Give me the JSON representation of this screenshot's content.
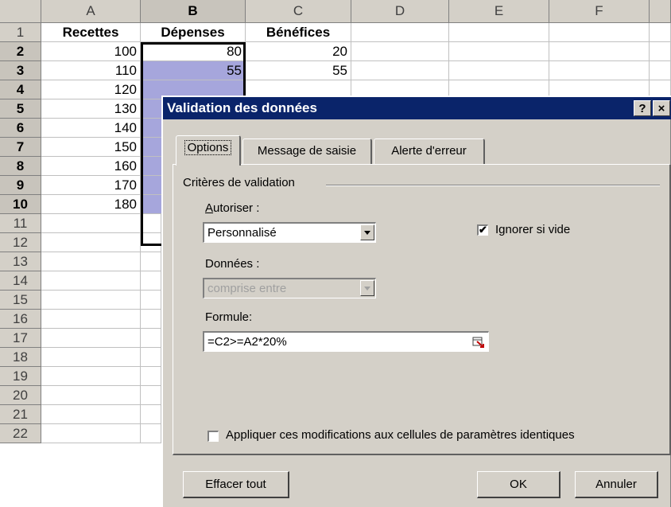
{
  "sheet": {
    "columns": [
      "A",
      "B",
      "C",
      "D",
      "E",
      "F"
    ],
    "rows": [
      "1",
      "2",
      "3",
      "4",
      "5",
      "6",
      "7",
      "8",
      "9",
      "10",
      "11",
      "12",
      "13",
      "14",
      "15",
      "16",
      "17",
      "18",
      "19",
      "20",
      "21",
      "22"
    ],
    "headers": {
      "a1": "Recettes",
      "b1": "Dépenses",
      "c1": "Bénéfices"
    },
    "recettes": [
      "100",
      "110",
      "120",
      "130",
      "140",
      "150",
      "160",
      "170",
      "180"
    ],
    "depenses": [
      "80",
      "55"
    ],
    "benefices": [
      "20",
      "55"
    ]
  },
  "dialog": {
    "title": "Validation des données",
    "help_button": "?",
    "close_button": "×",
    "tabs": [
      "Options",
      "Message de saisie",
      "Alerte d'erreur"
    ],
    "group_label": "Critères de validation",
    "autoriser_label": "Autoriser :",
    "autoriser_value": "Personnalisé",
    "ignorer_label": "Ignorer si vide",
    "ignorer_checked": true,
    "donnees_label": "Données :",
    "donnees_value": "comprise entre",
    "formule_label": "Formule:",
    "formule_value": "=C2>=A2*20%",
    "appliquer_label": "Appliquer ces modifications aux cellules de paramètres identiques",
    "appliquer_checked": false,
    "effacer_button": "Effacer tout",
    "ok_button": "OK",
    "annuler_button": "Annuler"
  },
  "colors": {
    "title_bar": "#0a246a",
    "selection_fill": "#a6a6dc",
    "face": "#d4d0c8"
  }
}
